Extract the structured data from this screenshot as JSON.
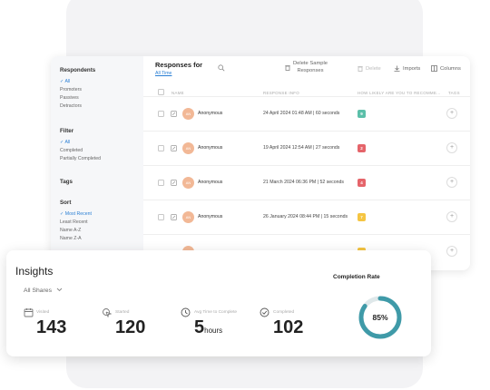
{
  "sidebar": {
    "respondents_title": "Respondents",
    "respondents": [
      {
        "label": "All",
        "selected": true
      },
      {
        "label": "Promoters",
        "selected": false
      },
      {
        "label": "Passives",
        "selected": false
      },
      {
        "label": "Detractors",
        "selected": false
      }
    ],
    "filter_title": "Filter",
    "filters": [
      {
        "label": "All",
        "selected": true
      },
      {
        "label": "Completed",
        "selected": false
      },
      {
        "label": "Partially Completed",
        "selected": false
      }
    ],
    "tags_title": "Tags",
    "sort_title": "Sort",
    "sorts": [
      {
        "label": "Most Recent",
        "selected": true
      },
      {
        "label": "Least Recent",
        "selected": false
      },
      {
        "label": "Name A-Z",
        "selected": false
      },
      {
        "label": "Name Z-A",
        "selected": false
      }
    ]
  },
  "header": {
    "title": "Responses for",
    "period_link": "All Time",
    "delete_sample_line1": "Delete Sample",
    "delete_sample_line2": "Responses",
    "delete_label": "Delete",
    "imports_label": "Imports",
    "columns_label": "Columns"
  },
  "table": {
    "columns": [
      "NAME",
      "RESPONSE INFO",
      "HOW LIKELY ARE YOU TO RECOMME...",
      "TAGS"
    ],
    "rows": [
      {
        "initials": "AN",
        "name": "Anonymous",
        "info": "24 April 2024 01:48 AM | 60 seconds",
        "score": "9",
        "score_color": "#5bbfa9"
      },
      {
        "initials": "AN",
        "name": "Anonymous",
        "info": "19 April 2024 12:54 AM | 27 seconds",
        "score": "2",
        "score_color": "#e5646a"
      },
      {
        "initials": "AN",
        "name": "Anonymous",
        "info": "21 March 2024 06:36 PM | 52 seconds",
        "score": "4",
        "score_color": "#e5646a"
      },
      {
        "initials": "AN",
        "name": "Anonymous",
        "info": "26 January 2024 08:44 PM | 15 seconds",
        "score": "7",
        "score_color": "#f5c542"
      }
    ]
  },
  "insights": {
    "title": "Insights",
    "shares_label": "All Shares",
    "stats": [
      {
        "label": "Visited",
        "value": "143",
        "unit": "",
        "icon": "calendar-icon"
      },
      {
        "label": "Started",
        "value": "120",
        "unit": "",
        "icon": "cursor-click-icon"
      },
      {
        "label": "Avg Time to Complete",
        "value": "5",
        "unit": "hours",
        "icon": "clock-icon"
      },
      {
        "label": "Completed",
        "value": "102",
        "unit": "",
        "icon": "check-circle-icon"
      }
    ],
    "completion_title": "Completion Rate",
    "completion_text": "85%",
    "completion_fraction": 0.85,
    "completion_color": "#3f9aa8",
    "track_color": "#dfe8ea"
  }
}
